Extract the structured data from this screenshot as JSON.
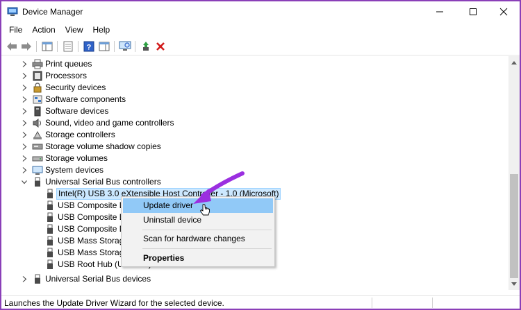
{
  "window": {
    "title": "Device Manager"
  },
  "menu": [
    "File",
    "Action",
    "View",
    "Help"
  ],
  "tree": [
    {
      "label": "Print queues",
      "icon": "printer-icon",
      "expanded": false
    },
    {
      "label": "Processors",
      "icon": "processor-icon",
      "expanded": false
    },
    {
      "label": "Security devices",
      "icon": "security-device-icon",
      "expanded": false
    },
    {
      "label": "Software components",
      "icon": "software-component-icon",
      "expanded": false
    },
    {
      "label": "Software devices",
      "icon": "software-device-icon",
      "expanded": false
    },
    {
      "label": "Sound, video and game controllers",
      "icon": "sound-icon",
      "expanded": false
    },
    {
      "label": "Storage controllers",
      "icon": "storage-controller-icon",
      "expanded": false
    },
    {
      "label": "Storage volume shadow copies",
      "icon": "shadow-copy-icon",
      "expanded": false
    },
    {
      "label": "Storage volumes",
      "icon": "storage-volume-icon",
      "expanded": false
    },
    {
      "label": "System devices",
      "icon": "system-device-icon",
      "expanded": false
    },
    {
      "label": "Universal Serial Bus controllers",
      "icon": "usb-icon",
      "expanded": true
    }
  ],
  "usb_children": [
    "Intel(R) USB 3.0 eXtensible Host Controller - 1.0 (Microsoft)",
    "USB Composite D",
    "USB Composite D",
    "USB Composite D",
    "USB Mass Storage",
    "USB Mass Storage",
    "USB Root Hub (USB 3.0)"
  ],
  "tree_after": {
    "label": "Universal Serial Bus devices",
    "icon": "usb-icon"
  },
  "context_menu": {
    "update": "Update driver",
    "uninstall": "Uninstall device",
    "scan": "Scan for hardware changes",
    "properties": "Properties"
  },
  "status": {
    "text": "Launches the Update Driver Wizard for the selected device."
  },
  "colors": {
    "accent_border": "#8a3fb8",
    "selection": "#cce8ff",
    "menu_hover": "#91c9f7",
    "annotation_arrow": "#9b2fe0"
  }
}
